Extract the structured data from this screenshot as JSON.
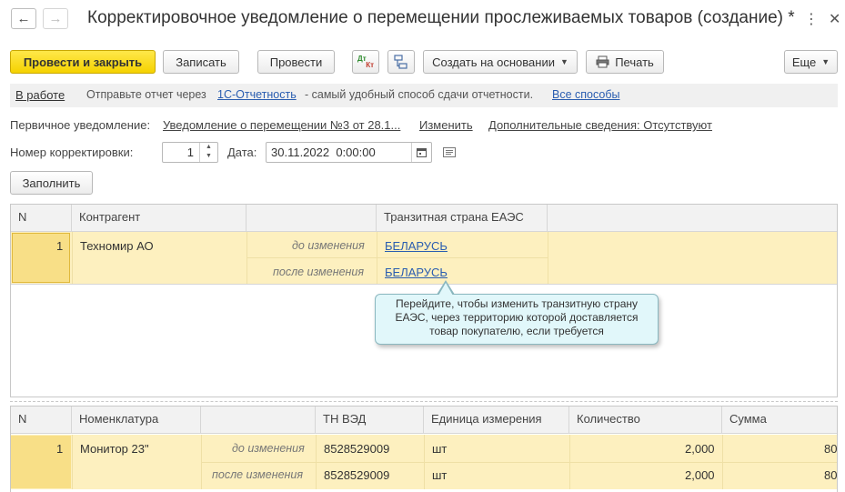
{
  "window": {
    "title": "Корректировочное уведомление о перемещении прослеживаемых товаров (создание) *",
    "back_icon": "←",
    "forward_icon": "→",
    "more_icon": "⋮",
    "close_icon": "✕"
  },
  "toolbar": {
    "post_close_label": "Провести и закрыть",
    "save_label": "Записать",
    "post_label": "Провести",
    "dt_kt_label_top": "Дт",
    "dt_kt_label_bottom": "Кт",
    "create_based_label": "Создать на основании",
    "print_label": "Печать",
    "more_label": "Еще"
  },
  "info_strip": {
    "at_work_label": "В работе",
    "text_before": "Отправьте отчет через",
    "service_link": "1С-Отчетность",
    "text_after": "- самый удобный способ сдачи отчетности.",
    "all_methods_link": "Все способы"
  },
  "form": {
    "primary_notice_label": "Первичное уведомление:",
    "primary_notice_link": "Уведомление о перемещении №3 от 28.1...",
    "change_link": "Изменить",
    "additional_info_link": "Дополнительные сведения: Отсутствуют",
    "correction_number_label": "Номер корректировки:",
    "correction_number_value": "1",
    "date_label": "Дата:",
    "date_value": "30.11.2022  0:00:00",
    "fill_button_label": "Заполнить"
  },
  "table1": {
    "headers": [
      "N",
      "Контрагент",
      "",
      "Транзитная страна ЕАЭС"
    ],
    "row": {
      "n": "1",
      "counterparty": "Техномир АО",
      "before_label": "до изменения",
      "after_label": "после изменения",
      "before_country": "БЕЛАРУСЬ",
      "after_country": "БЕЛАРУСЬ"
    }
  },
  "tooltip": {
    "text": "Перейдите, чтобы изменить транзитную страну ЕАЭС, через территорию которой доставляется товар покупателю, если требуется"
  },
  "table2": {
    "headers": [
      "N",
      "Номенклатура",
      "",
      "ТН ВЭД",
      "Единица измерения",
      "Количество",
      "Сумма"
    ],
    "row": {
      "n": "1",
      "item": "Монитор 23\"",
      "before_label": "до изменения",
      "after_label": "после изменения",
      "tnved_before": "8528529009",
      "tnved_after": "8528529009",
      "unit_before": "шт",
      "unit_after": "шт",
      "qty_before": "2,000",
      "qty_after": "2,000",
      "sum_before": "80",
      "sum_after": "80"
    }
  },
  "colors": {
    "primary_button": "#f5d200",
    "row_highlight": "#fdf0bf",
    "link": "#2a5db0",
    "tooltip_bg": "#e1f7fa"
  }
}
